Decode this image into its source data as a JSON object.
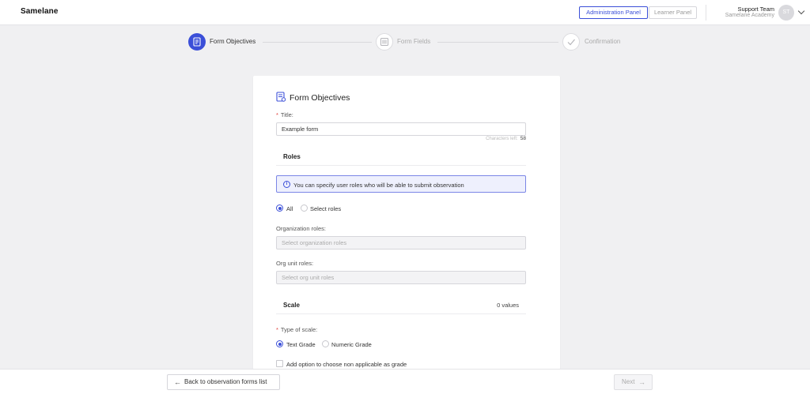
{
  "app": {
    "logo": "Samelane"
  },
  "header": {
    "admin_panel": "Administration Panel",
    "learner_panel": "Learner Panel",
    "user_name": "Support Team",
    "user_org": "Samelane Academy",
    "avatar_initials": "ST"
  },
  "stepper": {
    "steps": [
      {
        "label": "Form Objectives",
        "state": "active"
      },
      {
        "label": "Form Fields",
        "state": "inactive"
      },
      {
        "label": "Confirmation",
        "state": "inactive"
      }
    ]
  },
  "form": {
    "title": "Form Objectives",
    "title_field": {
      "label": "Title:",
      "value": "Example form",
      "chars_left_label": "Characters left:",
      "chars_left_value": "58"
    },
    "roles": {
      "heading": "Roles",
      "info": "You can specify user roles who will be able to submit observation",
      "options": [
        "All",
        "Select roles"
      ],
      "selected": "All",
      "org_roles_label": "Organization roles:",
      "org_roles_placeholder": "Select organization roles",
      "org_unit_roles_label": "Org unit roles:",
      "org_unit_roles_placeholder": "Select org unit roles"
    },
    "scale": {
      "heading": "Scale",
      "count": "0 values",
      "type_label": "Type of scale:",
      "options": [
        "Text Grade",
        "Numeric Grade"
      ],
      "selected": "Text Grade",
      "na_option": "Add option to choose non applicable as grade"
    }
  },
  "footer": {
    "back_label": "Back to observation forms list",
    "next_label": "Next"
  },
  "colors": {
    "accent": "#3b4fd8",
    "required": "#e0403a"
  }
}
